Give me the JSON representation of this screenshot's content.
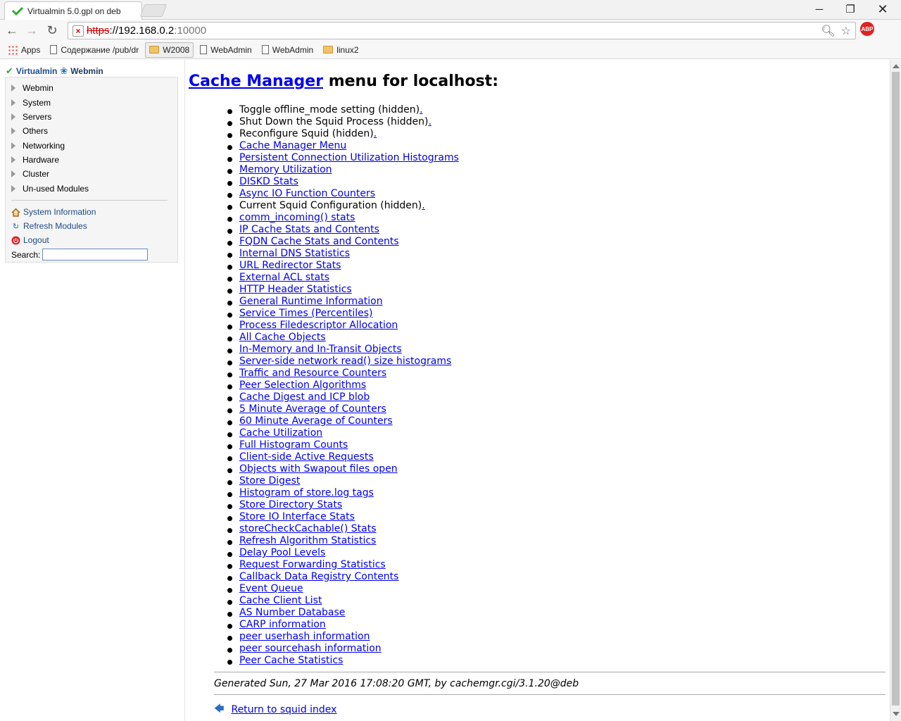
{
  "browser": {
    "tab_title": "Virtualmin 5.0.gpl on deb",
    "url_scheme": "https",
    "url_host": "://192.168.0.2",
    "url_port": ":10000",
    "window_controls": {
      "minimize": "─",
      "maximize": "❐",
      "close": "✕"
    },
    "bookmarks": [
      {
        "label": "Apps",
        "icon": "apps-grid-icon"
      },
      {
        "label": "Содержание /pub/dr",
        "icon": "page-icon"
      },
      {
        "label": "W2008",
        "icon": "folder-icon"
      },
      {
        "label": "WebAdmin",
        "icon": "page-icon"
      },
      {
        "label": "WebAdmin",
        "icon": "page-icon"
      },
      {
        "label": "linux2",
        "icon": "folder-icon"
      }
    ],
    "abp_label": "ABP"
  },
  "sidebar": {
    "virtualmin_label": "Virtualmin",
    "webmin_label": "Webmin",
    "categories": [
      "Webmin",
      "System",
      "Servers",
      "Others",
      "Networking",
      "Hardware",
      "Cluster",
      "Un-used Modules"
    ],
    "links": [
      {
        "label": "System Information",
        "icon": "home-icon"
      },
      {
        "label": "Refresh Modules",
        "icon": "refresh-icon"
      },
      {
        "label": "Logout",
        "icon": "power-icon"
      }
    ],
    "search_label": "Search:",
    "search_value": ""
  },
  "main": {
    "heading_link": "Cache Manager",
    "heading_rest": " menu for localhost:",
    "items": [
      {
        "text": "Toggle offline_mode setting (hidden)",
        "link": false
      },
      {
        "text": "Shut Down the Squid Process (hidden)",
        "link": false
      },
      {
        "text": "Reconfigure Squid (hidden)",
        "link": false
      },
      {
        "text": "Cache Manager Menu",
        "link": true
      },
      {
        "text": "Persistent Connection Utilization Histograms",
        "link": true
      },
      {
        "text": "Memory Utilization",
        "link": true
      },
      {
        "text": "DISKD Stats",
        "link": true
      },
      {
        "text": "Async IO Function Counters",
        "link": true
      },
      {
        "text": "Current Squid Configuration (hidden)",
        "link": false
      },
      {
        "text": "comm_incoming() stats",
        "link": true
      },
      {
        "text": "IP Cache Stats and Contents",
        "link": true
      },
      {
        "text": "FQDN Cache Stats and Contents",
        "link": true
      },
      {
        "text": "Internal DNS Statistics",
        "link": true
      },
      {
        "text": "URL Redirector Stats",
        "link": true
      },
      {
        "text": "External ACL stats",
        "link": true
      },
      {
        "text": "HTTP Header Statistics",
        "link": true
      },
      {
        "text": "General Runtime Information",
        "link": true
      },
      {
        "text": "Service Times (Percentiles)",
        "link": true
      },
      {
        "text": "Process Filedescriptor Allocation",
        "link": true
      },
      {
        "text": "All Cache Objects",
        "link": true
      },
      {
        "text": "In-Memory and In-Transit Objects",
        "link": true
      },
      {
        "text": "Server-side network read() size histograms",
        "link": true
      },
      {
        "text": "Traffic and Resource Counters",
        "link": true
      },
      {
        "text": "Peer Selection Algorithms",
        "link": true
      },
      {
        "text": "Cache Digest and ICP blob",
        "link": true
      },
      {
        "text": "5 Minute Average of Counters",
        "link": true
      },
      {
        "text": "60 Minute Average of Counters",
        "link": true
      },
      {
        "text": "Cache Utilization",
        "link": true
      },
      {
        "text": "Full Histogram Counts",
        "link": true
      },
      {
        "text": "Client-side Active Requests",
        "link": true
      },
      {
        "text": "Objects with Swapout files open",
        "link": true
      },
      {
        "text": "Store Digest",
        "link": true
      },
      {
        "text": "Histogram of store.log tags",
        "link": true
      },
      {
        "text": "Store Directory Stats",
        "link": true
      },
      {
        "text": "Store IO Interface Stats",
        "link": true
      },
      {
        "text": "storeCheckCachable() Stats",
        "link": true
      },
      {
        "text": "Refresh Algorithm Statistics",
        "link": true
      },
      {
        "text": "Delay Pool Levels",
        "link": true
      },
      {
        "text": "Request Forwarding Statistics",
        "link": true
      },
      {
        "text": "Callback Data Registry Contents",
        "link": true
      },
      {
        "text": "Event Queue",
        "link": true
      },
      {
        "text": "Cache Client List",
        "link": true
      },
      {
        "text": "AS Number Database",
        "link": true
      },
      {
        "text": "CARP information",
        "link": true
      },
      {
        "text": "peer userhash information",
        "link": true
      },
      {
        "text": "peer sourcehash information",
        "link": true
      },
      {
        "text": "Peer Cache Statistics",
        "link": true
      }
    ],
    "generated": "Generated Sun, 27 Mar 2016 17:08:20 GMT, by cachemgr.cgi/3.1.20@deb",
    "return_link": "Return to squid index"
  },
  "colors": {
    "link": "#0000ee",
    "sidebar_link": "#1c4a86",
    "insecure_scheme": "#cc0000"
  }
}
